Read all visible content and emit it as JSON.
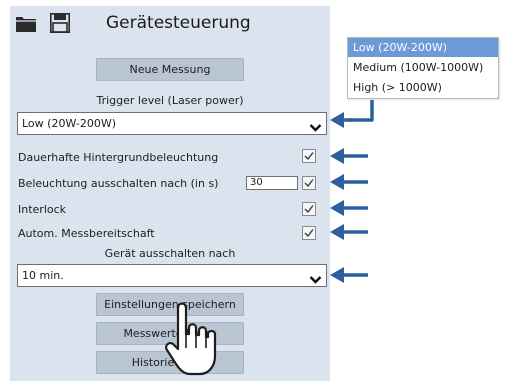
{
  "header": {
    "title": "Gerätesteuerung",
    "icons": [
      "folder-icon",
      "save-icon"
    ]
  },
  "buttons": {
    "new_measurement": "Neue Messung",
    "save_settings": "Einstellungen speichern",
    "measured_values": "Messwerte laden",
    "history": "Historie laden"
  },
  "trigger": {
    "label": "Trigger level (Laser power)",
    "value": "Low (20W-200W)",
    "options": [
      {
        "label": "Low (20W-200W)",
        "selected": true
      },
      {
        "label": "Medium (100W-1000W)",
        "selected": false
      },
      {
        "label": "High (> 1000W)",
        "selected": false
      }
    ]
  },
  "settings": {
    "background_light": {
      "label": "Dauerhafte Hintergrundbeleuchtung",
      "checked": true
    },
    "light_off_after": {
      "label": "Beleuchtung ausschalten nach (in s)",
      "value": "30",
      "checked": true
    },
    "interlock": {
      "label": "Interlock",
      "checked": true
    },
    "auto_ready": {
      "label": "Autom. Messbereitschaft",
      "checked": true
    }
  },
  "shutdown": {
    "label": "Gerät ausschalten nach",
    "value": "10 min."
  },
  "colors": {
    "panel_bg": "#dbe3ee",
    "button_bg": "#b9c5d3",
    "accent_arrow": "#2d5ea0",
    "selected_option": "#6c9ad6"
  }
}
